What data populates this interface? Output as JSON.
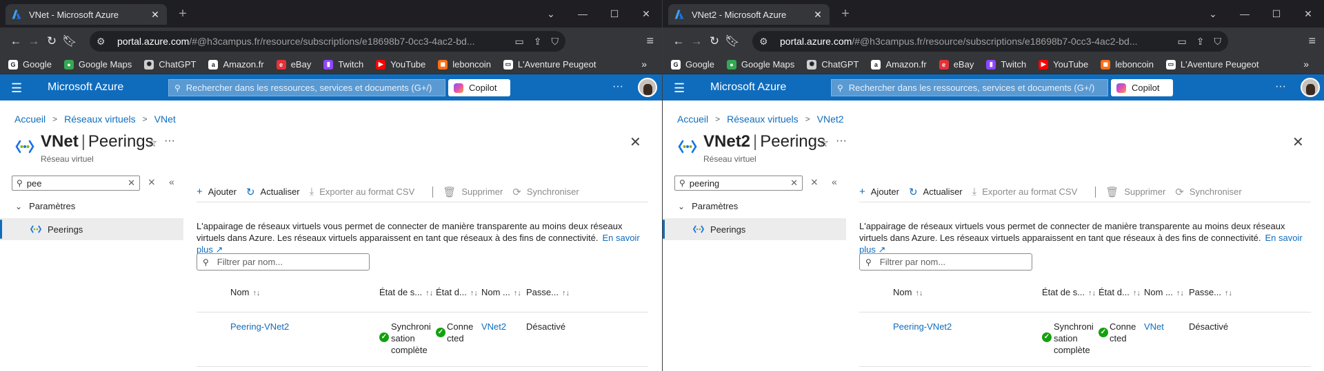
{
  "windows": [
    {
      "tab_title": "VNet - Microsoft Azure",
      "url": "portal.azure.com/#@h3campus.fr/resource/subscriptions/e18698b7-0cc3-4ac2-bd...",
      "url_host": "portal.azure.com",
      "url_rest": "/#@h3campus.fr/resource/subscriptions/e18698b7-0cc3-4ac2-bd...",
      "breadcrumb": [
        "Accueil",
        "Réseaux virtuels",
        "VNet"
      ],
      "resource_name": "VNet",
      "blade": "Peerings",
      "subtitle": "Réseau virtuel",
      "left_search": "pee",
      "row": {
        "name": "Peering-VNet2",
        "sync": "Synchroni\nsation\ncomplète",
        "state": "Conne\ncted",
        "remote": "VNet2",
        "gateway": "Désactivé"
      }
    },
    {
      "tab_title": "VNet2 - Microsoft Azure",
      "url": "portal.azure.com/#@h3campus.fr/resource/subscriptions/e18698b7-0cc3-4ac2-bd...",
      "url_host": "portal.azure.com",
      "url_rest": "/#@h3campus.fr/resource/subscriptions/e18698b7-0cc3-4ac2-bd...",
      "breadcrumb": [
        "Accueil",
        "Réseaux virtuels",
        "VNet2"
      ],
      "resource_name": "VNet2",
      "blade": "Peerings",
      "subtitle": "Réseau virtuel",
      "left_search": "peering",
      "row": {
        "name": "Peering-VNet2",
        "sync": "Synchroni\nsation\ncomplète",
        "state": "Conne\ncted",
        "remote": "VNet",
        "gateway": "Désactivé"
      }
    }
  ],
  "bookmarks": [
    {
      "label": "Google",
      "icon": "google-icon",
      "color": "#ffffff"
    },
    {
      "label": "Google Maps",
      "icon": "maps-pin-icon",
      "color": "#34a853"
    },
    {
      "label": "ChatGPT",
      "icon": "chatgpt-icon",
      "color": "#cfcfcf"
    },
    {
      "label": "Amazon.fr",
      "icon": "amazon-icon",
      "color": "#ffffff"
    },
    {
      "label": "eBay",
      "icon": "ebay-icon",
      "color": "#e53238"
    },
    {
      "label": "Twitch",
      "icon": "twitch-icon",
      "color": "#9146ff"
    },
    {
      "label": "YouTube",
      "icon": "youtube-icon",
      "color": "#ff0000"
    },
    {
      "label": "leboncoin",
      "icon": "leboncoin-icon",
      "color": "#ff6e14"
    },
    {
      "label": "L'Aventure Peugeot",
      "icon": "peugeot-icon",
      "color": "#ffffff"
    }
  ],
  "azure": {
    "brand": "Microsoft Azure",
    "search_placeholder": "Rechercher dans les ressources, services et documents (G+/)",
    "copilot": "Copilot",
    "more": "···"
  },
  "menu": {
    "group": "Paramètres",
    "item": "Peerings"
  },
  "commands": {
    "add": "Ajouter",
    "refresh": "Actualiser",
    "export": "Exporter au format CSV",
    "delete": "Supprimer",
    "sync": "Synchroniser"
  },
  "description": "L'appairage de réseaux virtuels vous permet de connecter de manière transparente au moins deux réseaux virtuels dans Azure. Les réseaux virtuels apparaissent en tant que réseaux à des fins de connectivité.",
  "learn_more": "En savoir plus",
  "filter_placeholder": "Filtrer par nom...",
  "columns": [
    "Nom",
    "État de s...",
    "État d...",
    "Nom ...",
    "Passe..."
  ],
  "colors": {
    "azure_blue": "#0f6cbd",
    "success": "#13a10e",
    "chrome_dark": "#35363a"
  }
}
